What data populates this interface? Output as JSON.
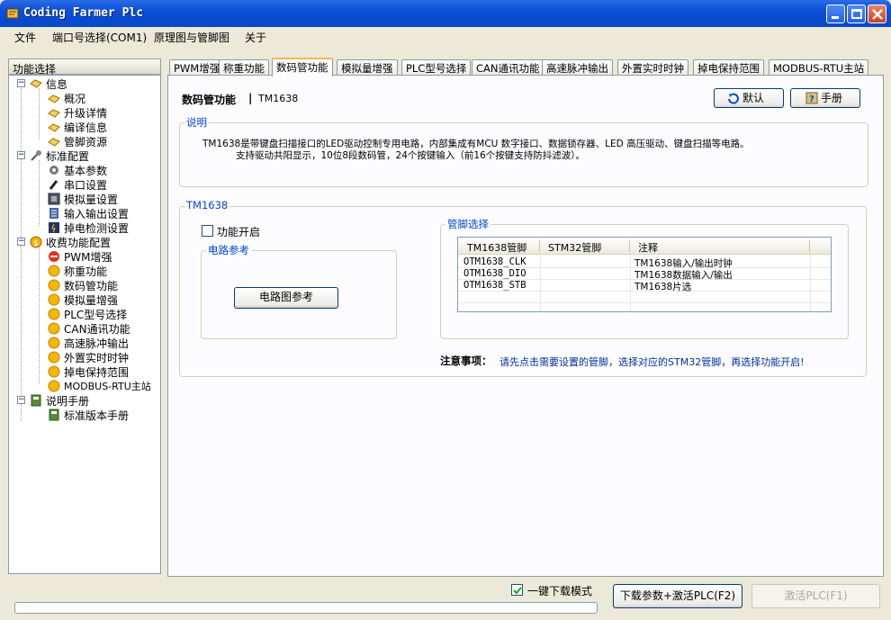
{
  "window": {
    "title": "Coding Farmer Plc"
  },
  "menu": [
    "文件",
    "端口号选择(COM1)",
    "原理图与管脚图",
    "关于"
  ],
  "sidebar": {
    "header": "功能选择",
    "groups": [
      {
        "label": "信息",
        "items": [
          "概况",
          "升级详情",
          "编译信息",
          "管脚资源"
        ]
      },
      {
        "label": "标准配置",
        "items": [
          "基本参数",
          "串口设置",
          "模拟量设置",
          "输入输出设置",
          "掉电检测设置"
        ]
      },
      {
        "label": "收费功能配置",
        "items": [
          "PWM增强",
          "称重功能",
          "数码管功能",
          "模拟量增强",
          "PLC型号选择",
          "CAN通讯功能",
          "高速脉冲输出",
          "外置实时时钟",
          "掉电保持范围",
          "MODBUS-RTU主站"
        ]
      },
      {
        "label": "说明手册",
        "items": [
          "标准版本手册"
        ]
      }
    ]
  },
  "tabs": [
    "PWM增强",
    "称重功能",
    "数码管功能",
    "模拟量增强",
    "PLC型号选择",
    "CAN通讯功能",
    "高速脉冲输出",
    "外置实时时钟",
    "掉电保持范围",
    "MODBUS-RTU主站"
  ],
  "panel": {
    "title": "数码管功能",
    "separator": "|",
    "chip": "TM1638",
    "default_button": "默认",
    "manual_button": "手册",
    "desc_title": "说明",
    "desc_line1": "TM1638是带键盘扫描接口的LED驱动控制专用电路，内部集成有MCU 数字接口、数据锁存器、LED 高压驱动、键盘扫描等电路。",
    "desc_line2": "支持驱动共阳显示，10位8段数码管，24个按键输入（前16个按键支持防抖滤波）。",
    "tm_group_title": "TM1638",
    "enable_label": "功能开启",
    "circuit_title": "电路参考",
    "circuit_button": "电路图参考",
    "pins_title": "管脚选择",
    "pins_columns": [
      "TM1638管脚",
      "STM32管脚",
      "注释"
    ],
    "pins_rows": [
      [
        "OTM1638_CLK",
        "",
        "TM1638输入/输出时钟"
      ],
      [
        "OTM1638_DIO",
        "",
        "TM1638数据输入/输出"
      ],
      [
        "OTM1638_STB",
        "",
        "TM1638片选"
      ]
    ],
    "note_label": "注意事项：",
    "note_text": "请先点击需要设置的管脚，选择对应的STM32管脚，再选择功能开启!"
  },
  "bottom": {
    "oneclick_label": "一键下载模式",
    "oneclick_checked": true,
    "download_button": "下载参数+激活PLC(F2)",
    "activate_button": "激活PLC(F1)"
  }
}
